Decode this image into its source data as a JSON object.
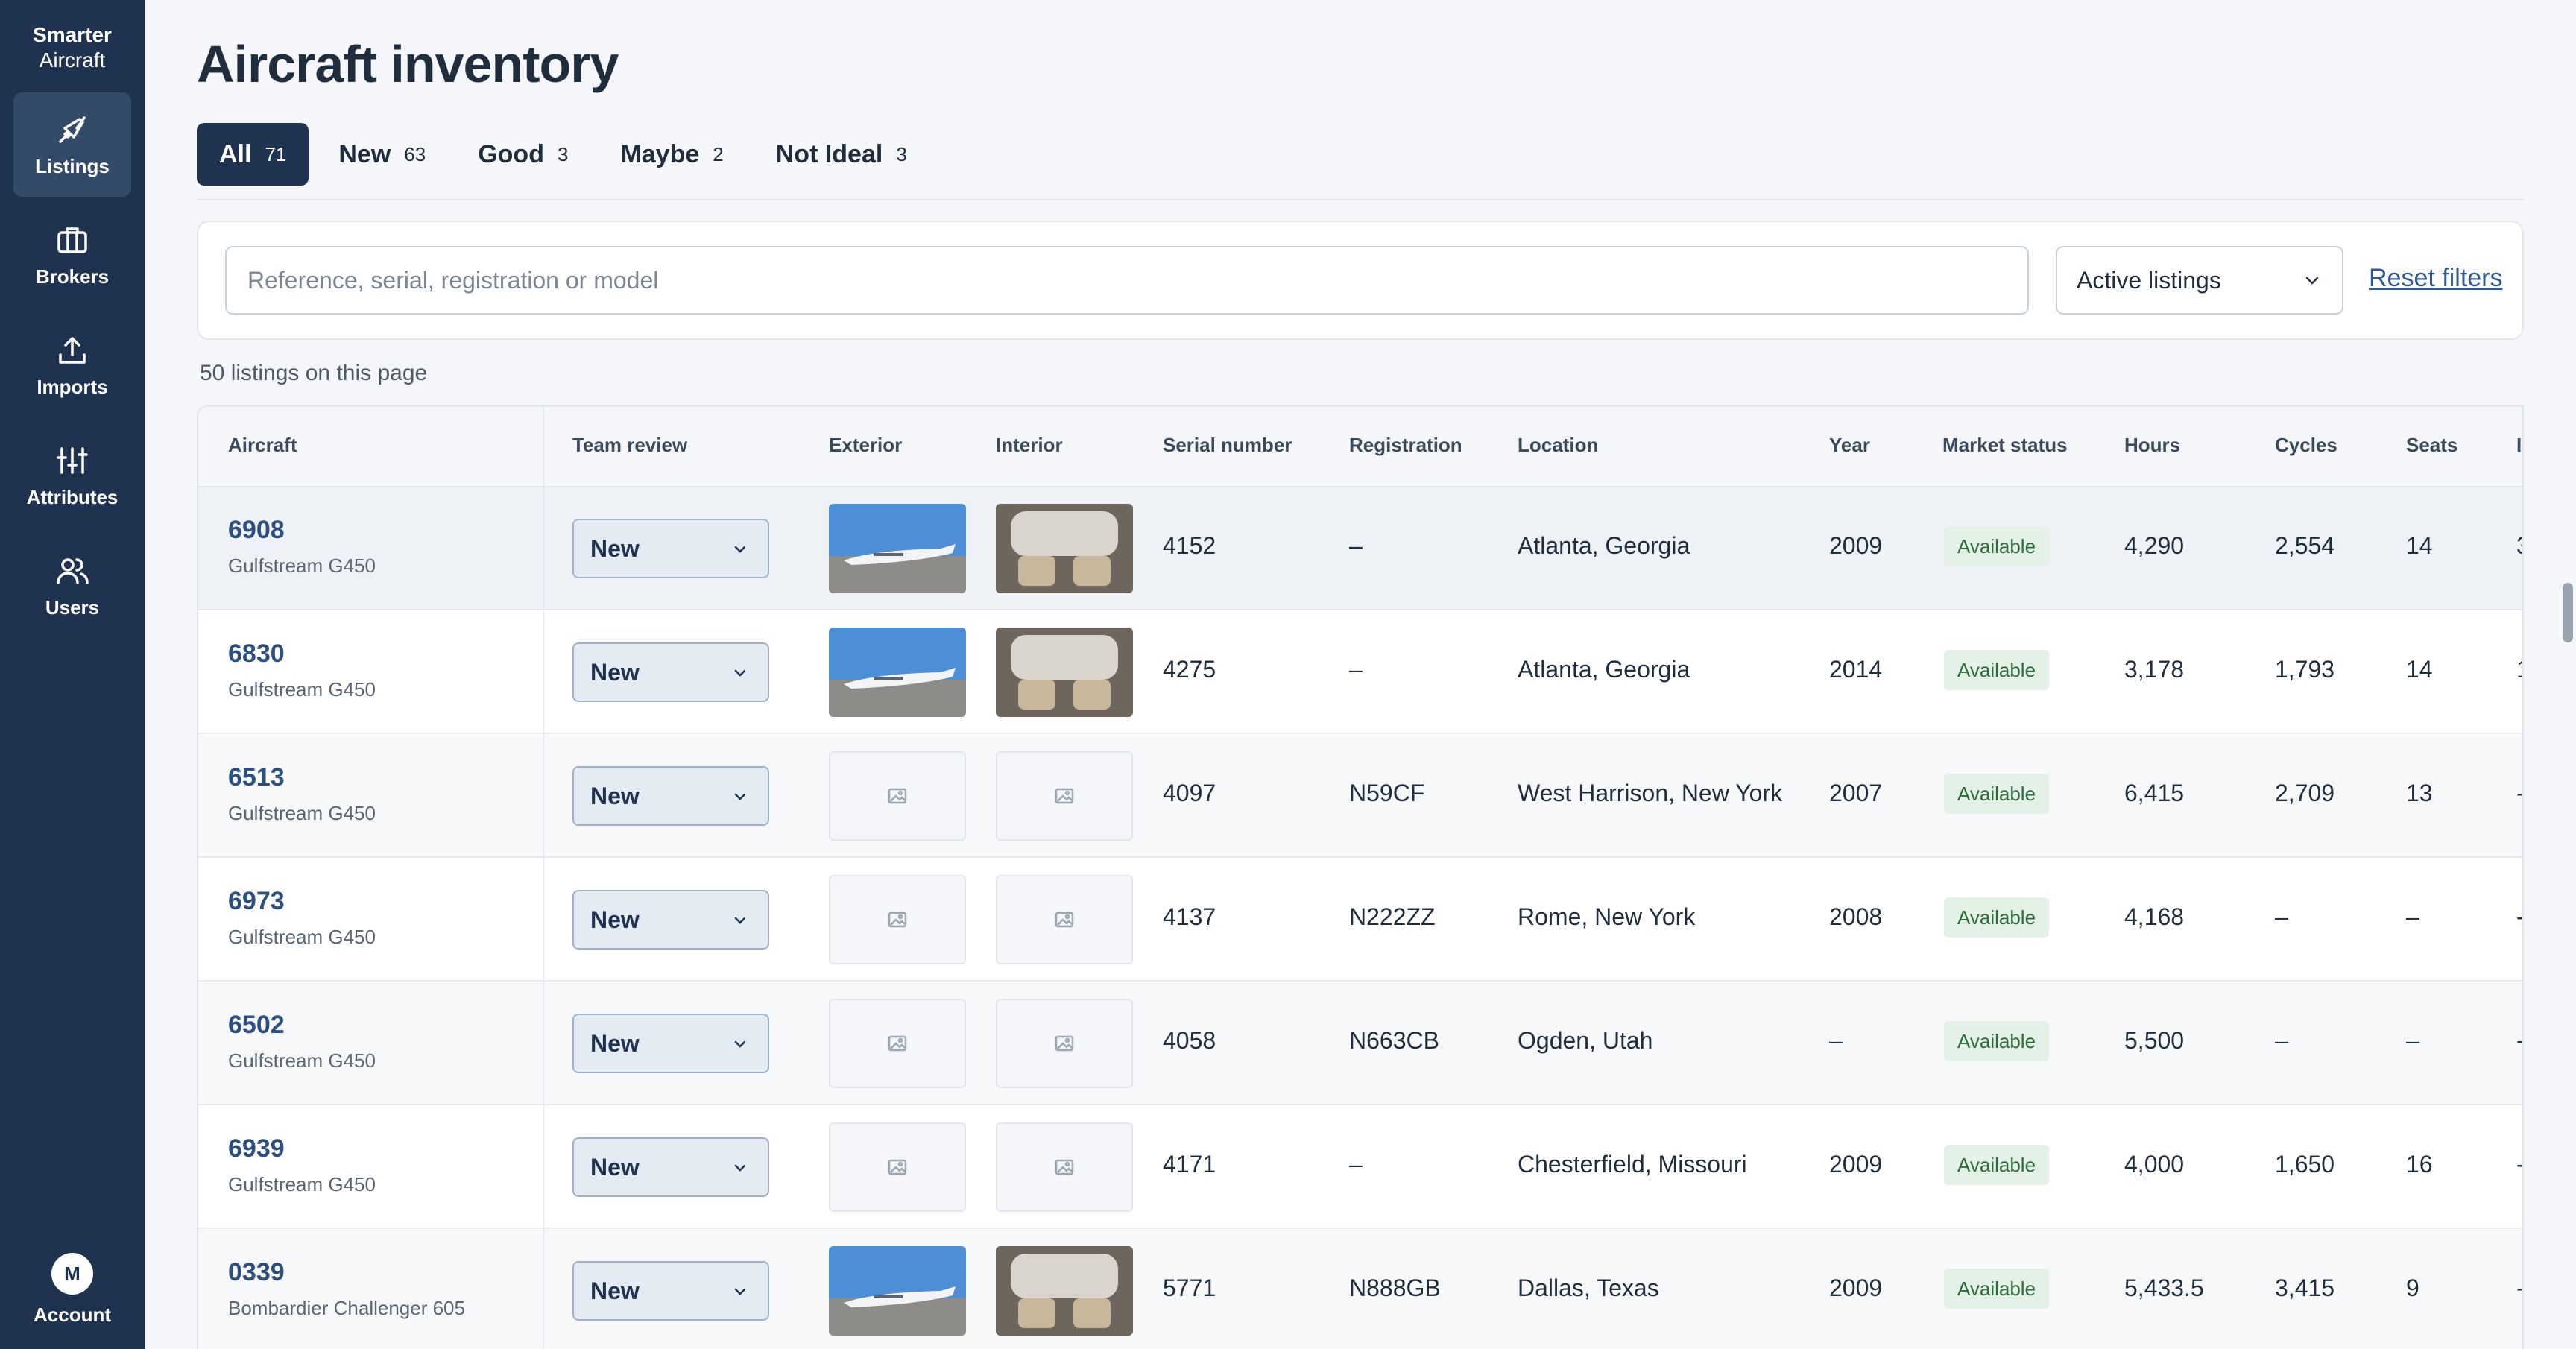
{
  "brand": {
    "line1": "Smarter",
    "line2": "Aircraft"
  },
  "nav": [
    {
      "label": "Listings",
      "icon": "plane-icon",
      "active": true
    },
    {
      "label": "Brokers",
      "icon": "briefcase-icon",
      "active": false
    },
    {
      "label": "Imports",
      "icon": "upload-icon",
      "active": false
    },
    {
      "label": "Attributes",
      "icon": "sliders-icon",
      "active": false
    },
    {
      "label": "Users",
      "icon": "users-icon",
      "active": false
    }
  ],
  "account": {
    "initial": "M",
    "label": "Account"
  },
  "page": {
    "title": "Aircraft inventory"
  },
  "tabs": [
    {
      "label": "All",
      "count": "71"
    },
    {
      "label": "New",
      "count": "63"
    },
    {
      "label": "Good",
      "count": "3"
    },
    {
      "label": "Maybe",
      "count": "2"
    },
    {
      "label": "Not Ideal",
      "count": "3"
    }
  ],
  "filters": {
    "search_placeholder": "Reference, serial, registration or model",
    "status_select": "Active listings",
    "reset_label": "Reset filters"
  },
  "listing_count": "50 listings on this page",
  "columns": {
    "aircraft": "Aircraft",
    "review": "Team review",
    "exterior": "Exterior",
    "interior": "Interior",
    "serial": "Serial number",
    "registration": "Registration",
    "location": "Location",
    "year": "Year",
    "market": "Market status",
    "hours": "Hours",
    "cycles": "Cycles",
    "seats": "Seats",
    "extra": "I"
  },
  "rows": [
    {
      "ref": "6908",
      "model": "Gulfstream G450",
      "review": "New",
      "photos": true,
      "serial": "4152",
      "registration": "–",
      "location": "Atlanta, Georgia",
      "year": "2009",
      "market": "Available",
      "hours": "4,290",
      "cycles": "2,554",
      "seats": "14",
      "extra": "3"
    },
    {
      "ref": "6830",
      "model": "Gulfstream G450",
      "review": "New",
      "photos": true,
      "serial": "4275",
      "registration": "–",
      "location": "Atlanta, Georgia",
      "year": "2014",
      "market": "Available",
      "hours": "3,178",
      "cycles": "1,793",
      "seats": "14",
      "extra": "1"
    },
    {
      "ref": "6513",
      "model": "Gulfstream G450",
      "review": "New",
      "photos": false,
      "serial": "4097",
      "registration": "N59CF",
      "location": "West Harrison, New York",
      "year": "2007",
      "market": "Available",
      "hours": "6,415",
      "cycles": "2,709",
      "seats": "13",
      "extra": "-"
    },
    {
      "ref": "6973",
      "model": "Gulfstream G450",
      "review": "New",
      "photos": false,
      "serial": "4137",
      "registration": "N222ZZ",
      "location": "Rome, New York",
      "year": "2008",
      "market": "Available",
      "hours": "4,168",
      "cycles": "–",
      "seats": "–",
      "extra": "-"
    },
    {
      "ref": "6502",
      "model": "Gulfstream G450",
      "review": "New",
      "photos": false,
      "serial": "4058",
      "registration": "N663CB",
      "location": "Ogden, Utah",
      "year": "–",
      "market": "Available",
      "hours": "5,500",
      "cycles": "–",
      "seats": "–",
      "extra": "-"
    },
    {
      "ref": "6939",
      "model": "Gulfstream G450",
      "review": "New",
      "photos": false,
      "serial": "4171",
      "registration": "–",
      "location": "Chesterfield, Missouri",
      "year": "2009",
      "market": "Available",
      "hours": "4,000",
      "cycles": "1,650",
      "seats": "16",
      "extra": "-"
    },
    {
      "ref": "0339",
      "model": "Bombardier Challenger 605",
      "review": "New",
      "photos": true,
      "serial": "5771",
      "registration": "N888GB",
      "location": "Dallas, Texas",
      "year": "2009",
      "market": "Available",
      "hours": "5,433.5",
      "cycles": "3,415",
      "seats": "9",
      "extra": "-"
    }
  ]
}
